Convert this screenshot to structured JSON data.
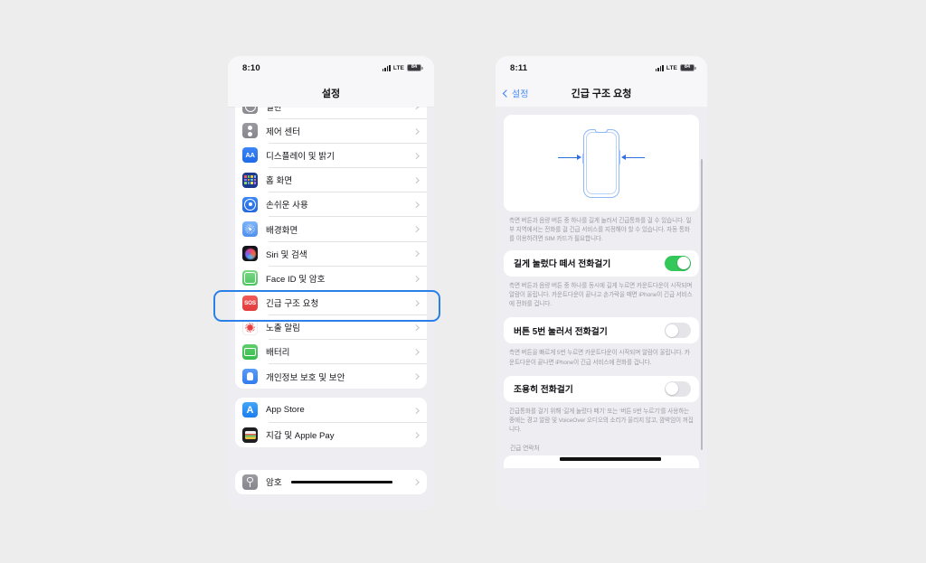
{
  "background_color": "#ededed",
  "accent_color": "#2b7fe8",
  "left_phone": {
    "status_bar": {
      "time": "8:10",
      "network": "LTE",
      "battery": "84",
      "signal_icon": "signal-bars-icon"
    },
    "nav": {
      "title": "설정"
    },
    "groups": [
      {
        "rows": [
          {
            "label": "일반",
            "icon": "general-icon",
            "icon_class": "ico-general",
            "partial": true
          },
          {
            "label": "제어 센터",
            "icon": "control-center-icon",
            "icon_class": "ico-control"
          },
          {
            "label": "디스플레이 및 밝기",
            "icon": "display-brightness-icon",
            "icon_class": "ico-display",
            "icon_text": "AA"
          },
          {
            "label": "홈 화면",
            "icon": "home-screen-icon",
            "icon_class": "ico-home"
          },
          {
            "label": "손쉬운 사용",
            "icon": "accessibility-icon",
            "icon_class": "ico-access"
          },
          {
            "label": "배경화면",
            "icon": "wallpaper-icon",
            "icon_class": "ico-wall"
          },
          {
            "label": "Siri 및 검색",
            "icon": "siri-search-icon",
            "icon_class": "ico-siri"
          },
          {
            "label": "Face ID 및 암호",
            "icon": "face-id-icon",
            "icon_class": "ico-faceid"
          },
          {
            "label": "긴급 구조 요청",
            "icon": "sos-icon",
            "icon_class": "ico-sos",
            "icon_text": "SOS",
            "highlighted": true
          },
          {
            "label": "노출 알림",
            "icon": "exposure-notification-icon",
            "icon_class": "ico-expo"
          },
          {
            "label": "배터리",
            "icon": "battery-icon",
            "icon_class": "ico-batt"
          },
          {
            "label": "개인정보 보호 및 보안",
            "icon": "privacy-security-icon",
            "icon_class": "ico-priv"
          }
        ]
      },
      {
        "rows": [
          {
            "label": "App Store",
            "icon": "app-store-icon",
            "icon_class": "ico-appstore",
            "icon_text": "A"
          },
          {
            "label": "지갑 및 Apple Pay",
            "icon": "wallet-applepay-icon",
            "icon_class": "ico-wallet"
          }
        ]
      },
      {
        "rows": [
          {
            "label": "암호",
            "icon": "passwords-icon",
            "icon_class": "ico-pass",
            "redacted": true
          }
        ]
      }
    ]
  },
  "right_phone": {
    "status_bar": {
      "time": "8:11",
      "network": "LTE",
      "battery": "84",
      "signal_icon": "signal-bars-icon"
    },
    "nav": {
      "back_label": "설정",
      "title": "긴급 구조 요청",
      "back_icon": "chevron-left-icon"
    },
    "illustration": {
      "name": "phone-side-buttons-illustration"
    },
    "intro_text": "측면 버튼과 음량 버튼 중 하나를 길게 눌러서 긴급통화를 걸 수 있습니다. 일부 지역에서는 전화를 걸 긴급 서비스를 지정해야 할 수 있습니다. 자동 통화를 이용하려면 SIM 카드가 필요합니다.",
    "settings": [
      {
        "label": "길게 눌렀다 떼서 전화걸기",
        "state": "on",
        "description": "측면 버튼과 음량 버튼 중 하나를 동시에 길게 누르면 카운트다운이 시작되며 알람이 울립니다. 카운트다운이 끝나고 손가락을 떼면 iPhone이 긴급 서비스에 전화를 겁니다."
      },
      {
        "label": "버튼 5번 눌러서 전화걸기",
        "state": "off",
        "description": "측면 버튼을 빠르게 5번 누르면 카운트다운이 시작되며 알람이 울립니다. 카운트다운이 끝나면 iPhone이 긴급 서비스에 전화를 겁니다."
      },
      {
        "label": "조용히 전화걸기",
        "state": "off",
        "description": "긴급통화를 걸기 위해 ‘길게 눌렀다 떼기’ 또는 ‘버튼 5번 누르기’를 사용하는 중에는 경고 알람 및 VoiceOver 오디오의 소리가 울리지 않고, 깜박임이 꺼집니다."
      }
    ],
    "contacts_section_title": "긴급 연락처"
  }
}
